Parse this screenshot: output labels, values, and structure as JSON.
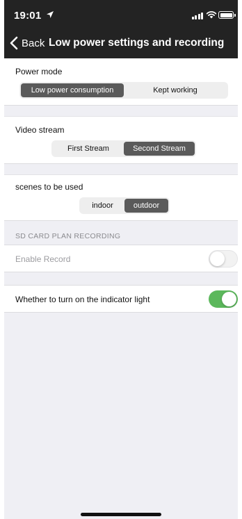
{
  "status_bar": {
    "time": "19:01",
    "icons": [
      "location-arrow-icon",
      "signal-icon",
      "wifi-icon",
      "battery-icon"
    ]
  },
  "nav": {
    "back_label": "Back",
    "title": "Low power settings and recording"
  },
  "power_mode": {
    "label": "Power mode",
    "options": [
      "Low power consumption",
      "Kept working"
    ],
    "selected": "Low power consumption"
  },
  "video_stream": {
    "label": "Video stream",
    "options": [
      "First Stream",
      "Second Stream"
    ],
    "selected": "Second Stream"
  },
  "scenes": {
    "label": "scenes to be used",
    "options": [
      "indoor",
      "outdoor"
    ],
    "selected": "outdoor"
  },
  "sd_card": {
    "header": "SD CARD PLAN RECORDING",
    "enable_record_label": "Enable Record",
    "enable_record_on": false
  },
  "indicator_light": {
    "label": "Whether to turn on the indicator light",
    "on": true
  },
  "colors": {
    "header_bg": "#232323",
    "page_bg": "#efeff4",
    "segment_active": "#5a5a5a",
    "toggle_on": "#5cb85c"
  }
}
